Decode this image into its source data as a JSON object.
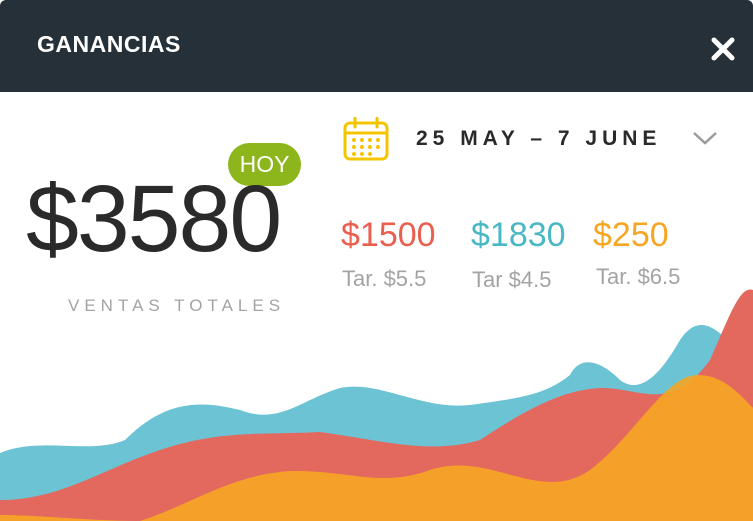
{
  "header": {
    "title": "GANANCIAS",
    "close_icon": "close-icon"
  },
  "today_badge": "HOY",
  "total": {
    "value": "$3580",
    "label": "VENTAS TOTALES"
  },
  "date_range": {
    "label": "25 MAY – 7 JUNE",
    "calendar_icon": "calendar-icon",
    "dropdown_icon": "chevron-down-icon"
  },
  "stats": [
    {
      "value": "$1500",
      "tariff": "Tar. $5.5",
      "color": "#e95f50"
    },
    {
      "value": "$1830",
      "tariff": "Tar $4.5",
      "color": "#4ab8c4"
    },
    {
      "value": "$250",
      "tariff": "Tar. $6.5",
      "color": "#f5a623"
    }
  ],
  "colors": {
    "header_bg": "#263038",
    "badge": "#8db61c",
    "red": "#e95f50",
    "teal": "#4ab8c4",
    "orange": "#f5a623"
  }
}
